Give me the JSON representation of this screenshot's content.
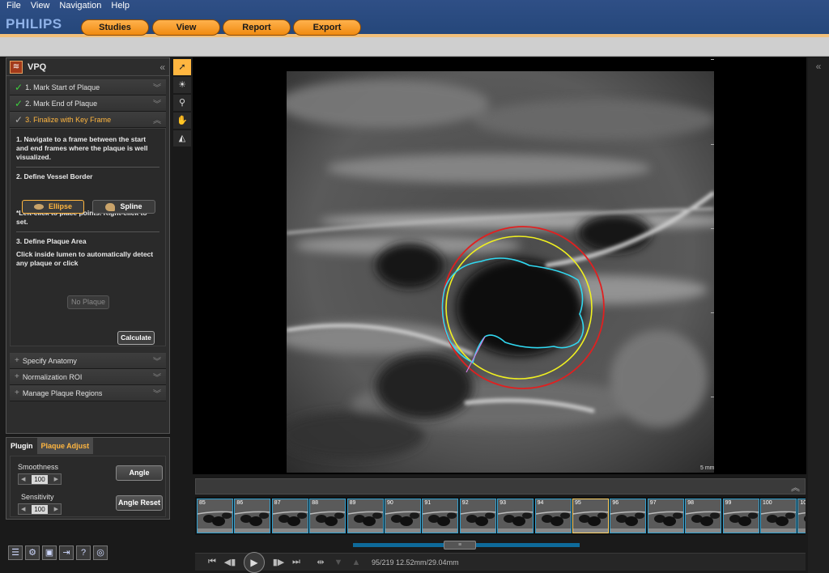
{
  "menu": [
    "File",
    "View",
    "Navigation",
    "Help"
  ],
  "brand": "PHILIPS",
  "top_tabs": [
    "Studies",
    "View",
    "Report",
    "Export"
  ],
  "left_panel": {
    "title": "VPQ",
    "steps": [
      {
        "label": "1. Mark Start of Plaque",
        "state": "done"
      },
      {
        "label": "2. Mark End of Plaque",
        "state": "done"
      },
      {
        "label": "3. Finalize with Key Frame",
        "state": "active"
      }
    ],
    "step3": {
      "intro": "1. Navigate to a frame between the start and end frames where the plaque is well visualized.",
      "vessel_heading": "2. Define Vessel Border",
      "ellipse_label": "Ellipse",
      "spline_label": "Spline",
      "hint": "*Left-click to place points. Right-click to set.",
      "plaque_heading": "3. Define Plaque Area",
      "plaque_text": "Click inside lumen to automatically detect any plaque or click",
      "no_plaque_label": "No Plaque",
      "calculate_label": "Calculate"
    },
    "collapsed_sections": [
      "Specify Anatomy",
      "Normalization ROI",
      "Manage Plaque Regions"
    ]
  },
  "plugin_panel": {
    "tabs": [
      "Plugin",
      "Plaque Adjust"
    ],
    "smoothness_label": "Smoothness",
    "smoothness_value": "100",
    "sensitivity_label": "Sensitivity",
    "sensitivity_value": "100",
    "angle_label": "Angle",
    "angle_reset_label": "Angle Reset"
  },
  "viewer": {
    "scale_label": "5 mm"
  },
  "filmstrip": {
    "frames": [
      "85",
      "86",
      "87",
      "88",
      "89",
      "90",
      "91",
      "92",
      "93",
      "94",
      "95",
      "96",
      "97",
      "98",
      "99",
      "100",
      "10"
    ],
    "selected": "95"
  },
  "playback": {
    "status": "95/219  12.52mm/29.04mm"
  },
  "colors": {
    "accent_orange": "#ffb640",
    "vessel_red": "#e02020",
    "ellipse_yellow": "#f0f020",
    "lumen_cyan": "#30d8f0",
    "filmstrip_border": "#2fa0d0"
  }
}
